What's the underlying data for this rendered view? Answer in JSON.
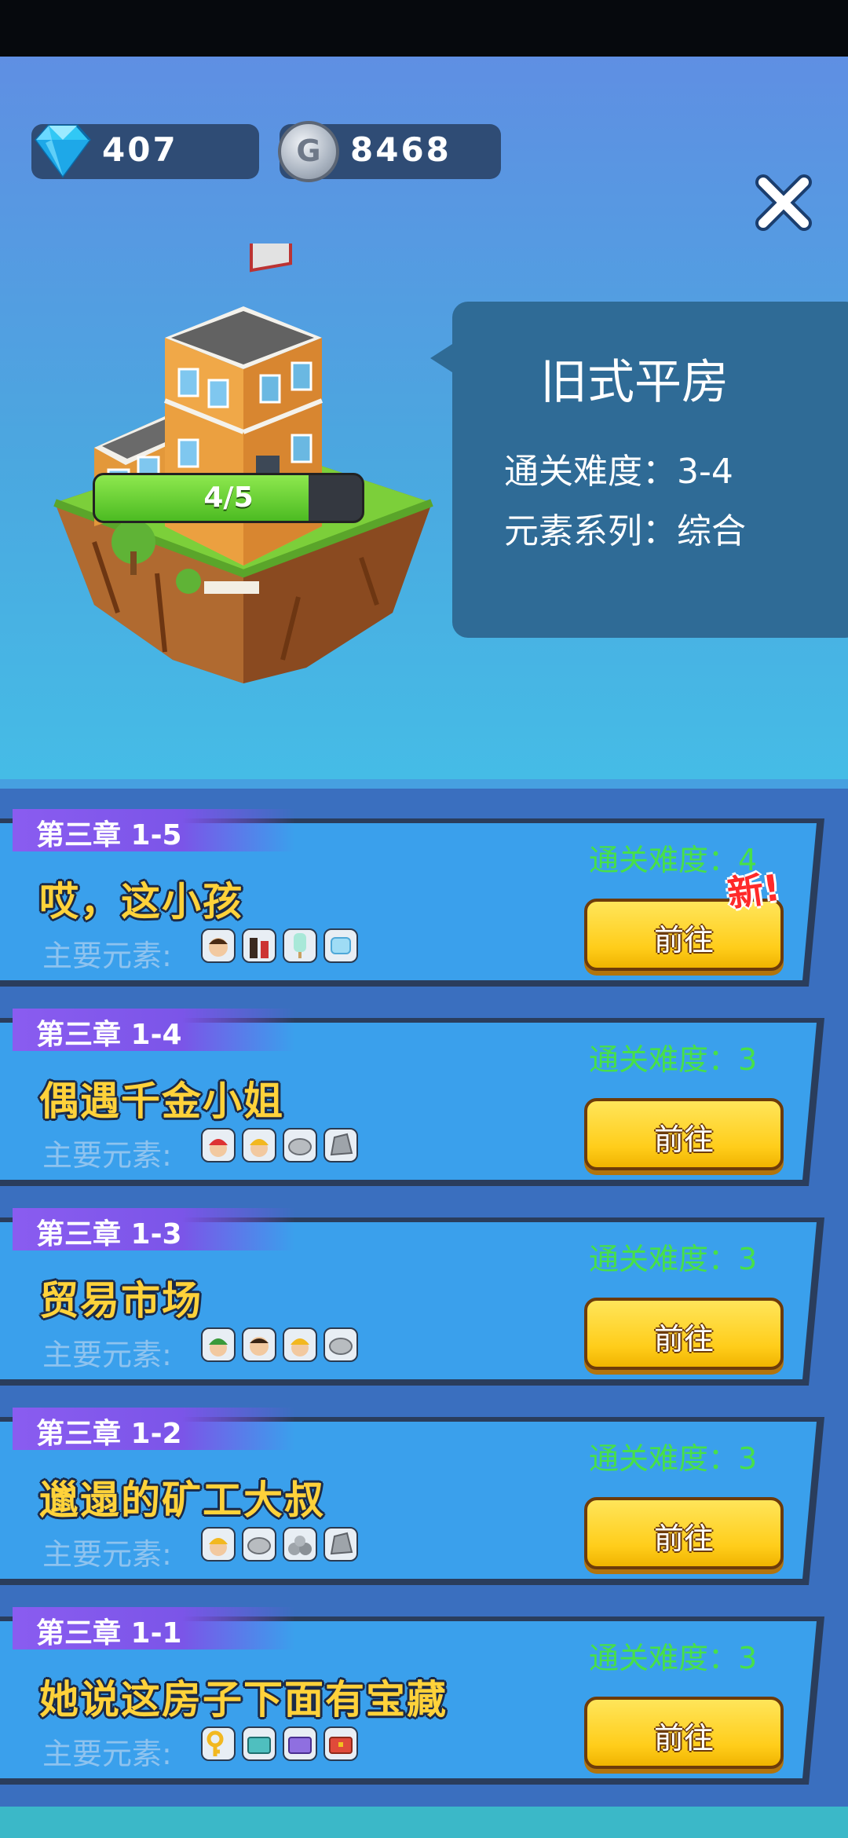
{
  "currency": {
    "gems": "407",
    "coins": "8468",
    "coin_symbol": "G"
  },
  "building": {
    "name": "旧式平房",
    "difficulty_line": "通关难度：3-4",
    "series_line": "元素系列：综合",
    "progress_text": "4/5",
    "progress_fraction": 0.8
  },
  "levels": [
    {
      "chapter": "第三章 1-5",
      "title": "哎，这小孩",
      "element_label": "主要元素:",
      "difficulty": "通关难度：4",
      "button": "前往",
      "new_badge": "新!",
      "elements": [
        "boy-face-icon",
        "soda-bottles-icon",
        "popsicle-icon",
        "ice-cube-icon"
      ]
    },
    {
      "chapter": "第三章 1-4",
      "title": "偶遇千金小姐",
      "element_label": "主要元素:",
      "difficulty": "通关难度：3",
      "button": "前往",
      "elements": [
        "red-hat-worker-icon",
        "miner-helmet-icon",
        "stone-icon",
        "rock-icon"
      ]
    },
    {
      "chapter": "第三章 1-3",
      "title": "贸易市场",
      "element_label": "主要元素:",
      "difficulty": "通关难度：3",
      "button": "前往",
      "elements": [
        "green-cap-man-icon",
        "man-face-icon",
        "miner-helmet-icon",
        "stone-icon"
      ]
    },
    {
      "chapter": "第三章 1-2",
      "title": "邋遢的矿工大叔",
      "element_label": "主要元素:",
      "difficulty": "通关难度：3",
      "button": "前往",
      "elements": [
        "miner-helmet-icon",
        "stone-icon",
        "rock-pile-icon",
        "rock-icon"
      ]
    },
    {
      "chapter": "第三章 1-1",
      "title": "她说这房子下面有宝藏",
      "element_label": "主要元素:",
      "difficulty": "通关难度：3",
      "button": "前往",
      "elements": [
        "key-icon",
        "teal-chest-icon",
        "purple-chest-icon",
        "red-chest-icon"
      ]
    }
  ]
}
